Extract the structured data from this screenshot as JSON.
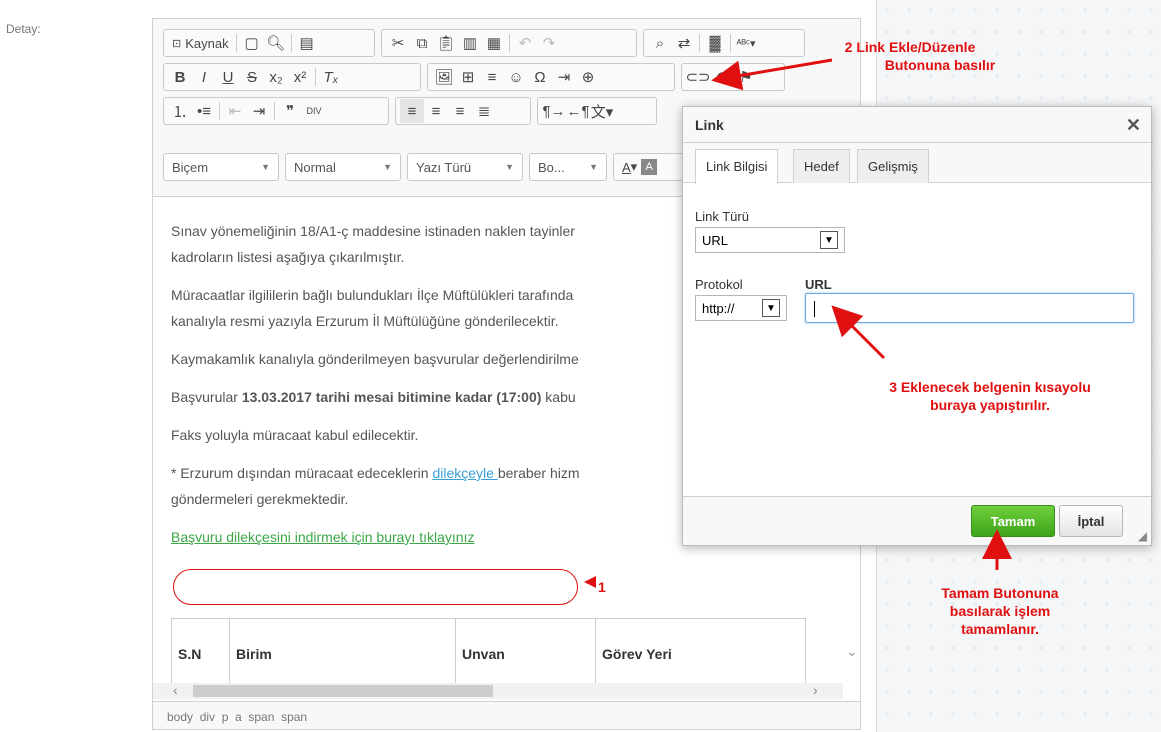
{
  "page": {
    "detail_label": "Detay:"
  },
  "toolbar": {
    "source_label": "Kaynak",
    "format_combo": "Biçem",
    "normal_combo": "Normal",
    "font_combo": "Yazı Türü",
    "size_combo": "Bo...",
    "font_color_label": "A"
  },
  "content": {
    "p1_a": "Sınav yönemeliğinin 18/A1-ç maddesine istinaden naklen tayinler",
    "p1_b": "kadroların listesi aşağıya çıkarılmıştır.",
    "p2_a": "Müracaatlar ilgililerin bağlı bulundukları İlçe Müftülükleri tarafında",
    "p2_b": "kanalıyla resmi yazıyla Erzurum İl Müftülüğüne gönderilecektir.",
    "p3": "Kaymakamlık kanalıyla gönderilmeyen başvurular değerlendirilme",
    "p4_pre": "Başvurular ",
    "p4_bold": "13.03.2017 tarihi mesai bitimine kadar (17:00)",
    "p4_post": " kabu",
    "p5": "Faks yoluyla müracaat kabul edilecektir.",
    "p6_pre": "* Erzurum dışından müracaat edeceklerin ",
    "p6_link": "dilekçeyle ",
    "p6_post": "beraber hizm",
    "p6_b": "göndermeleri gerekmektedir.",
    "download_link": "Başvuru dilekçesini indirmek için burayı tıklayınız",
    "table_headers": [
      "S.N",
      "Birim",
      "Unvan",
      "Görev Yeri"
    ]
  },
  "statusbar": {
    "path": "body  div  p  a  span  span"
  },
  "dialog": {
    "title": "Link",
    "close": "✕",
    "tabs": [
      "Link Bilgisi",
      "Hedef",
      "Gelişmiş"
    ],
    "link_type_label": "Link Türü",
    "link_type_value": "URL",
    "protocol_label": "Protokol",
    "protocol_value": "http://",
    "url_label": "URL",
    "url_value": "",
    "ok_label": "Tamam",
    "cancel_label": "İptal"
  },
  "annotations": {
    "a1": "1",
    "a2_line1": "2  Link Ekle/Düzenle",
    "a2_line2": "Butonuna basılır",
    "a3_line1": "3 Eklenecek belgenin kısayolu",
    "a3_line2": "buraya yapıştırılır.",
    "a4_line1": "Tamam Butonuna",
    "a4_line2": "basılarak işlem",
    "a4_line3": "tamamlanır."
  },
  "colors": {
    "annotation": "#e01010",
    "ok_button": "#4caf20",
    "link_green": "#3aa845",
    "link_blue": "#3a9fd6"
  }
}
